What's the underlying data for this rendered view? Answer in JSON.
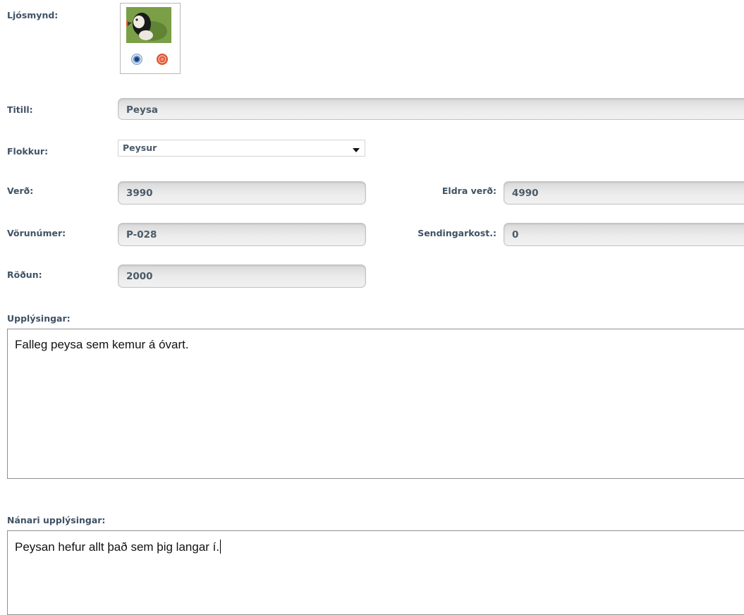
{
  "photo": {
    "label": "Ljósmynd:",
    "view_icon": "view-icon",
    "delete_icon": "delete-icon"
  },
  "title": {
    "label": "Titill:",
    "value": "Peysa"
  },
  "category": {
    "label": "Flokkur:",
    "value": "Peysur"
  },
  "price": {
    "label": "Verð:",
    "value": "3990"
  },
  "old_price": {
    "label": "Eldra verð:",
    "value": "4990"
  },
  "product_number": {
    "label": "Vörunúmer:",
    "value": "P-028"
  },
  "shipping": {
    "label": "Sendingarkost.:",
    "value": "0"
  },
  "order": {
    "label": "Röðun:",
    "value": "2000"
  },
  "info": {
    "label": "Upplýsingar:",
    "value": "Falleg peysa sem kemur á óvart."
  },
  "more_info": {
    "label": "Nánari upplýsingar:",
    "value": "Peysan hefur allt það sem þig langar í."
  }
}
